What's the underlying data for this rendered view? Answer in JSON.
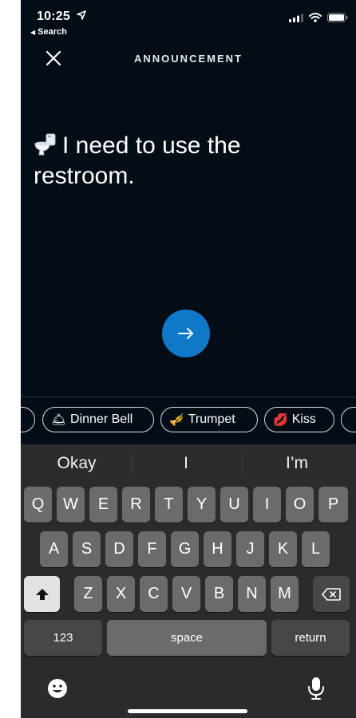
{
  "status_bar": {
    "time": "10:25",
    "back_label": "Search"
  },
  "header": {
    "title": "ANNOUNCEMENT"
  },
  "message": {
    "text": "I need to use the restroom."
  },
  "chips": [
    {
      "emoji": "🛎",
      "label": "Dinner Bell"
    },
    {
      "emoji": "🎺",
      "label": "Trumpet"
    },
    {
      "emoji": "💋",
      "label": "Kiss"
    }
  ],
  "keyboard": {
    "suggestions": [
      "Okay",
      "I",
      "I’m"
    ],
    "row1": [
      "Q",
      "W",
      "E",
      "R",
      "T",
      "Y",
      "U",
      "I",
      "O",
      "P"
    ],
    "row2": [
      "A",
      "S",
      "D",
      "F",
      "G",
      "H",
      "J",
      "K",
      "L"
    ],
    "row3": [
      "Z",
      "X",
      "C",
      "V",
      "B",
      "N",
      "M"
    ],
    "numbers_label": "123",
    "space_label": "space",
    "return_label": "return"
  },
  "colors": {
    "accent": "#0f78c8",
    "background": "#040c16",
    "keyboard": "#2b2b2d"
  }
}
